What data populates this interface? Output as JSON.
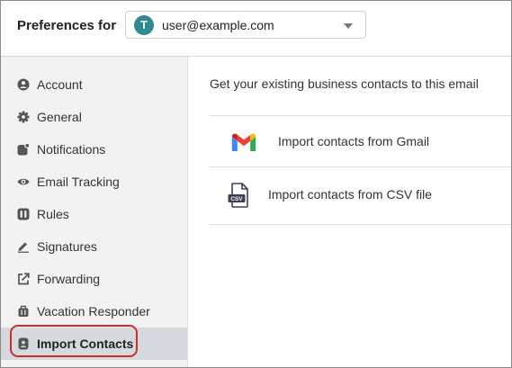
{
  "header": {
    "title": "Preferences for",
    "account": {
      "initial": "T",
      "email": "user@example.com",
      "avatar_color": "#2f8a93"
    }
  },
  "sidebar": {
    "items": [
      {
        "label": "Account",
        "icon": "user-circle-icon"
      },
      {
        "label": "General",
        "icon": "gear-icon"
      },
      {
        "label": "Notifications",
        "icon": "notification-bell-icon"
      },
      {
        "label": "Email Tracking",
        "icon": "eye-icon"
      },
      {
        "label": "Rules",
        "icon": "rules-icon"
      },
      {
        "label": "Signatures",
        "icon": "pen-icon"
      },
      {
        "label": "Forwarding",
        "icon": "forward-icon"
      },
      {
        "label": "Vacation Responder",
        "icon": "suitcase-icon"
      },
      {
        "label": "Import Contacts",
        "icon": "contact-icon",
        "active": true
      }
    ],
    "active_color": "#d6d9de",
    "highlight_color": "#cf2b2b"
  },
  "main": {
    "intro": "Get your existing business contacts to this email",
    "options": [
      {
        "label": "Import contacts from Gmail",
        "icon": "gmail-icon"
      },
      {
        "label": "Import contacts from CSV file",
        "icon": "csv-file-icon",
        "icon_text": "CSV"
      }
    ]
  }
}
